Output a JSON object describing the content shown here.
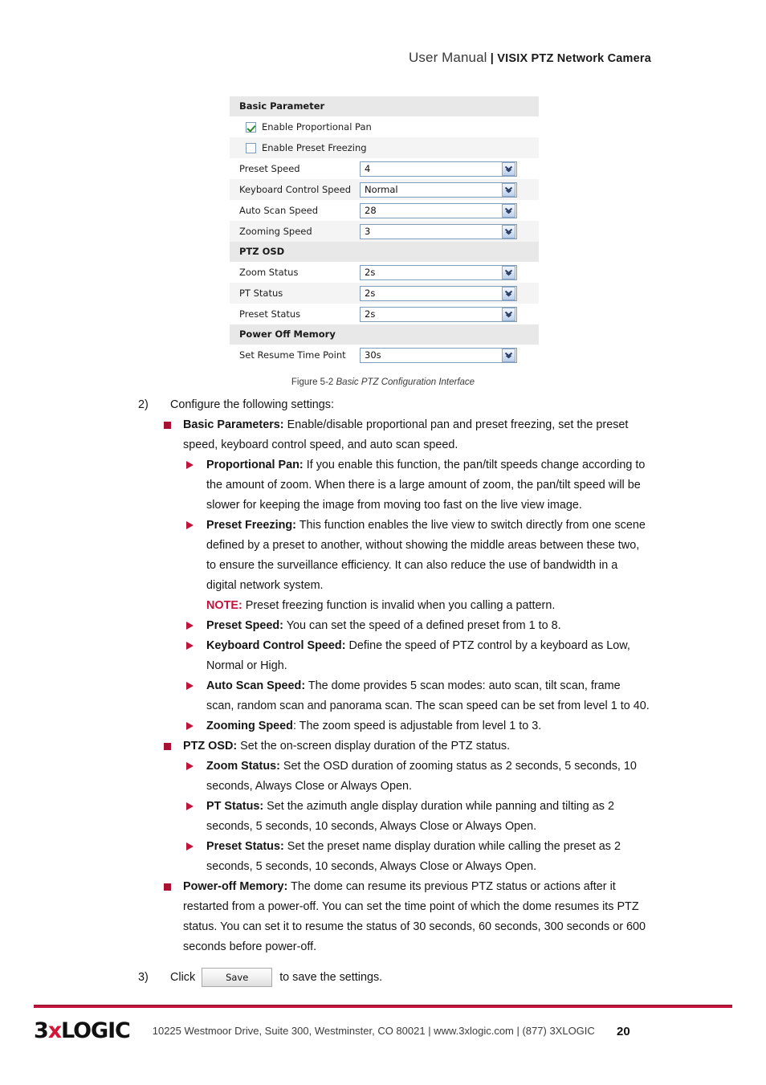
{
  "header": {
    "title_light": "User Manual",
    "separator": " | ",
    "title_bold": "VISIX PTZ Network Camera"
  },
  "settings_panel": {
    "sections": [
      {
        "heading": "Basic Parameter",
        "checkboxes": [
          {
            "label": "Enable Proportional Pan",
            "checked": true
          },
          {
            "label": "Enable Preset Freezing",
            "checked": false
          }
        ],
        "fields": [
          {
            "label": "Preset Speed",
            "value": "4"
          },
          {
            "label": "Keyboard Control Speed",
            "value": "Normal"
          },
          {
            "label": "Auto Scan Speed",
            "value": "28"
          },
          {
            "label": "Zooming Speed",
            "value": "3"
          }
        ]
      },
      {
        "heading": "PTZ OSD",
        "checkboxes": [],
        "fields": [
          {
            "label": "Zoom Status",
            "value": "2s"
          },
          {
            "label": "PT Status",
            "value": "2s"
          },
          {
            "label": "Preset Status",
            "value": "2s"
          }
        ]
      },
      {
        "heading": "Power Off Memory",
        "checkboxes": [],
        "fields": [
          {
            "label": "Set Resume Time Point",
            "value": "30s"
          }
        ]
      }
    ]
  },
  "figure_caption": {
    "number": "Figure 5-2 ",
    "title": "Basic PTZ Configuration Interface"
  },
  "steps": {
    "step2_number": "2)",
    "step2_text": "Configure the following settings:",
    "step3_number": "3)",
    "step3_click": "Click",
    "step3_save_label": "Save",
    "step3_tail": "to save the settings."
  },
  "content": {
    "basic_parameters": {
      "lead": "Basic Parameters:",
      "body": " Enable/disable proportional pan and preset freezing, set the preset speed, keyboard control speed, and auto scan speed."
    },
    "proportional_pan": {
      "lead": "Proportional Pan:",
      "body": " If you enable this function, the pan/tilt speeds change according to the amount of zoom. When there is a large amount of zoom, the pan/tilt speed will be slower for keeping the image from moving too fast on the live view image."
    },
    "preset_freezing": {
      "lead": "Preset Freezing:",
      "body": " This function enables the live view to switch directly from one scene defined by a preset to another, without showing the middle areas between these two, to ensure the surveillance efficiency. It can also reduce the use of bandwidth in a digital network system.",
      "note_label": "NOTE:",
      "note_body": " Preset freezing function is invalid when you calling a pattern."
    },
    "preset_speed": {
      "lead": "Preset Speed:",
      "body": " You can set the speed of a defined preset from 1 to 8."
    },
    "keyboard_control_speed": {
      "lead": "Keyboard Control Speed:",
      "body": " Define the speed of PTZ control by a keyboard as Low, Normal or High."
    },
    "auto_scan_speed": {
      "lead": "Auto Scan Speed:",
      "body": " The dome provides 5 scan modes: auto scan, tilt scan, frame scan, random scan and panorama scan. The scan speed can be set from level 1 to 40."
    },
    "zooming_speed": {
      "lead": "Zooming Speed",
      "body": ": The zoom speed is adjustable from level 1 to 3."
    },
    "ptz_osd": {
      "lead": "PTZ OSD:",
      "body": " Set the on-screen display duration of the PTZ status."
    },
    "zoom_status": {
      "lead": "Zoom Status:",
      "body": " Set the OSD duration of zooming status as 2 seconds, 5 seconds, 10 seconds, Always Close or Always Open."
    },
    "pt_status": {
      "lead": "PT Status:",
      "body": " Set the azimuth angle display duration while panning and tilting as 2 seconds, 5 seconds, 10 seconds, Always Close or Always Open."
    },
    "preset_status": {
      "lead": "Preset Status:",
      "body": " Set the preset name display duration while calling the preset as 2 seconds, 5 seconds, 10 seconds, Always Close or Always Open."
    },
    "power_off_memory": {
      "lead": "Power-off Memory:",
      "body": " The dome can resume its previous PTZ status or actions after it restarted from a power-off. You can set the time point of which the dome resumes its PTZ status. You can set it to resume the status of 30 seconds, 60 seconds, 300 seconds or 600 seconds before power-off."
    }
  },
  "footer": {
    "logo_part1": "3",
    "logo_x": "x",
    "logo_part2": "LOGIC",
    "address": "10225 Westmoor Drive, Suite 300, Westminster, CO 80021 | www.3xlogic.com | (877) 3XLOGIC",
    "page_number": "20"
  },
  "colors": {
    "accent_red": "#c0143c",
    "bullet_maroon": "#a91034",
    "section_header_bg": "#e8e8e8",
    "alt_row_bg": "#f4f4f4"
  }
}
